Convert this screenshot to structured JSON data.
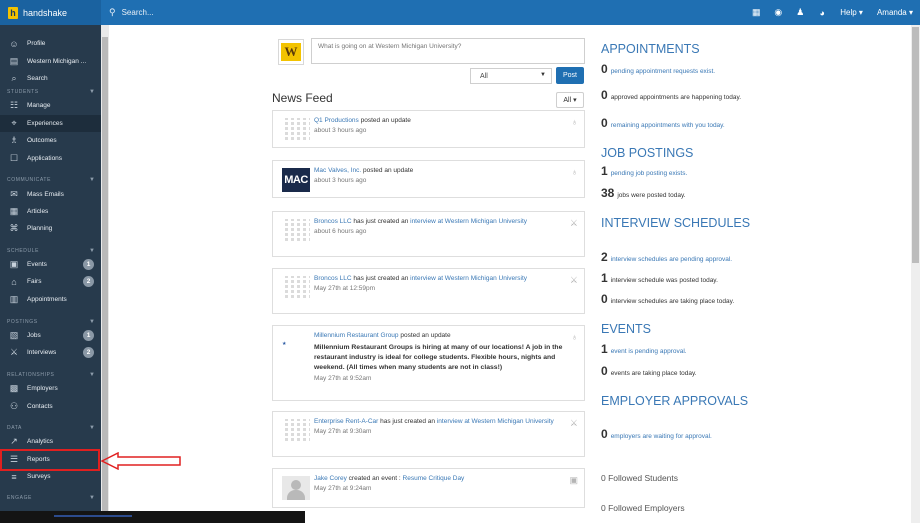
{
  "topbar": {
    "brand": "handshake",
    "search_label": "Search...",
    "help": "Help",
    "user": "Amanda"
  },
  "sidebar": {
    "top_items": [
      {
        "label": "Profile",
        "icon": "user-icon"
      },
      {
        "label": "Western Michigan ...",
        "icon": "document-icon"
      },
      {
        "label": "Search",
        "icon": "search-icon"
      }
    ],
    "sections": [
      {
        "title": "STUDENTS",
        "items": [
          {
            "label": "Manage",
            "icon": "people-icon"
          },
          {
            "label": "Experiences",
            "icon": "pin-icon",
            "active": true
          },
          {
            "label": "Outcomes",
            "icon": "trophy-icon"
          },
          {
            "label": "Applications",
            "icon": "applications-icon"
          }
        ]
      },
      {
        "title": "COMMUNICATE",
        "items": [
          {
            "label": "Mass Emails",
            "icon": "mail-icon"
          },
          {
            "label": "Articles",
            "icon": "newspaper-icon"
          },
          {
            "label": "Planning",
            "icon": "planning-icon"
          }
        ]
      },
      {
        "title": "SCHEDULE",
        "items": [
          {
            "label": "Events",
            "icon": "calendar-icon",
            "badge": "1"
          },
          {
            "label": "Fairs",
            "icon": "fair-icon",
            "badge": "2"
          },
          {
            "label": "Appointments",
            "icon": "appointment-icon"
          }
        ]
      },
      {
        "title": "POSTINGS",
        "items": [
          {
            "label": "Jobs",
            "icon": "briefcase-icon",
            "badge": "1"
          },
          {
            "label": "Interviews",
            "icon": "handshake-icon",
            "badge": "2"
          }
        ]
      },
      {
        "title": "RELATIONSHIPS",
        "items": [
          {
            "label": "Employers",
            "icon": "building-icon"
          },
          {
            "label": "Contacts",
            "icon": "contacts-icon"
          }
        ]
      },
      {
        "title": "DATA",
        "items": [
          {
            "label": "Analytics",
            "icon": "chart-icon"
          },
          {
            "label": "Reports",
            "icon": "report-icon"
          },
          {
            "label": "Surveys",
            "icon": "survey-icon"
          }
        ]
      },
      {
        "title": "ENGAGE",
        "items": []
      }
    ]
  },
  "composer": {
    "placeholder": "What is going on at Western Michigan University?",
    "audience": "All",
    "post_label": "Post"
  },
  "feed": {
    "title": "News Feed",
    "filter": "All",
    "cards": [
      {
        "actor": "Q1 Productions",
        "action": " posted an update",
        "time": "about 3 hours ago",
        "thumb": "building",
        "icon": "microphone-icon"
      },
      {
        "actor": "Mac Valves, Inc.",
        "action": " posted an update",
        "time": "about 3 hours ago",
        "thumb": "mac",
        "thumb_text": "MAC",
        "icon": "microphone-icon"
      },
      {
        "actor": "Broncos LLC",
        "action": " has just created an ",
        "link": "interview at Western Michigan University",
        "time": "about 6 hours ago",
        "thumb": "building",
        "icon": "handshake-icon"
      },
      {
        "actor": "Broncos LLC",
        "action": " has just created an ",
        "link": "interview at Western Michigan University",
        "time": "May 27th at 12:59pm",
        "thumb": "building",
        "icon": "handshake-icon"
      },
      {
        "actor": "Millennium Restaurant Group",
        "action": " posted an update",
        "message": "Millennium Restaurant Groups is hiring at many of our locations! A job in the restaurant industry is ideal for college students. Flexible hours, nights and weekend. (All times when many students are not in class!)",
        "time": "May 27th at 9:52am",
        "thumb": "millennium",
        "icon": "microphone-icon"
      },
      {
        "actor": "Enterprise Rent-A-Car",
        "action": " has just created an ",
        "link": "interview at Western Michigan University",
        "time": "May 27th at 9:30am",
        "thumb": "building",
        "icon": "handshake-icon"
      },
      {
        "actor": "Jake Corey",
        "action": " created an event : ",
        "link": "Resume Critique Day",
        "time": "May 27th at 9:24am",
        "thumb": "person",
        "icon": "calendar-icon"
      }
    ]
  },
  "summary": {
    "appointments": {
      "title": "APPOINTMENTS",
      "lines": [
        {
          "num": "0",
          "text": "pending appointment requests exist.",
          "link": true
        },
        {
          "num": "0",
          "text": "approved appointments are happening today.",
          "link": false
        },
        {
          "num": "0",
          "text": "remaining appointments with you today.",
          "link": true
        }
      ]
    },
    "job_postings": {
      "title": "JOB POSTINGS",
      "lines": [
        {
          "num": "1",
          "text": "pending job posting exists.",
          "link": true
        },
        {
          "num": "38",
          "text": "jobs were posted today.",
          "link": false
        }
      ]
    },
    "interview_schedules": {
      "title": "INTERVIEW SCHEDULES",
      "lines": [
        {
          "num": "2",
          "text": "interview schedules are pending approval.",
          "link": true
        },
        {
          "num": "1",
          "text": "interview schedule was posted today.",
          "link": false
        },
        {
          "num": "0",
          "text": "interview schedules are taking place today.",
          "link": false
        }
      ]
    },
    "events": {
      "title": "EVENTS",
      "lines": [
        {
          "num": "1",
          "text": "event is pending approval.",
          "link": true
        },
        {
          "num": "0",
          "text": "events are taking place today.",
          "link": false
        }
      ]
    },
    "employer_approvals": {
      "title": "EMPLOYER APPROVALS",
      "lines": [
        {
          "num": "0",
          "text": "employers are waiting for approval.",
          "link": true
        }
      ]
    },
    "followed_students": "0 Followed Students",
    "followed_employers": "0 Followed Employers"
  },
  "colors": {
    "topbar": "#1f6fb2",
    "sidebar": "#273a4c",
    "link": "#3a78b5",
    "highlight": "#e02020"
  }
}
